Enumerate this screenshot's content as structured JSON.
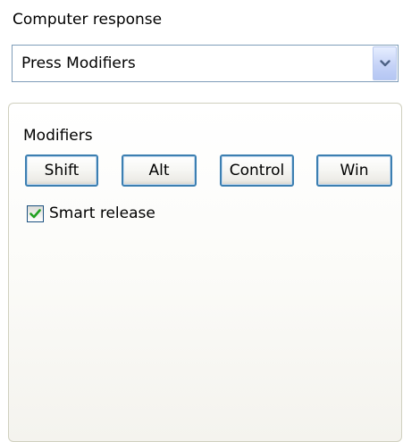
{
  "response": {
    "label": "Computer response",
    "selected": "Press Modifiers"
  },
  "modifiers": {
    "label": "Modifiers",
    "buttons": [
      "Shift",
      "Alt",
      "Control",
      "Win"
    ],
    "smart_release": {
      "label": "Smart release",
      "checked": true
    }
  },
  "icons": {
    "dropdown": "chevron-down-icon",
    "checkbox": "checkmark-icon"
  },
  "colors": {
    "button_border": "#3c7fb1",
    "combo_border": "#7f9db9",
    "checkmark": "#21a121",
    "arrow": "#4d6185"
  }
}
